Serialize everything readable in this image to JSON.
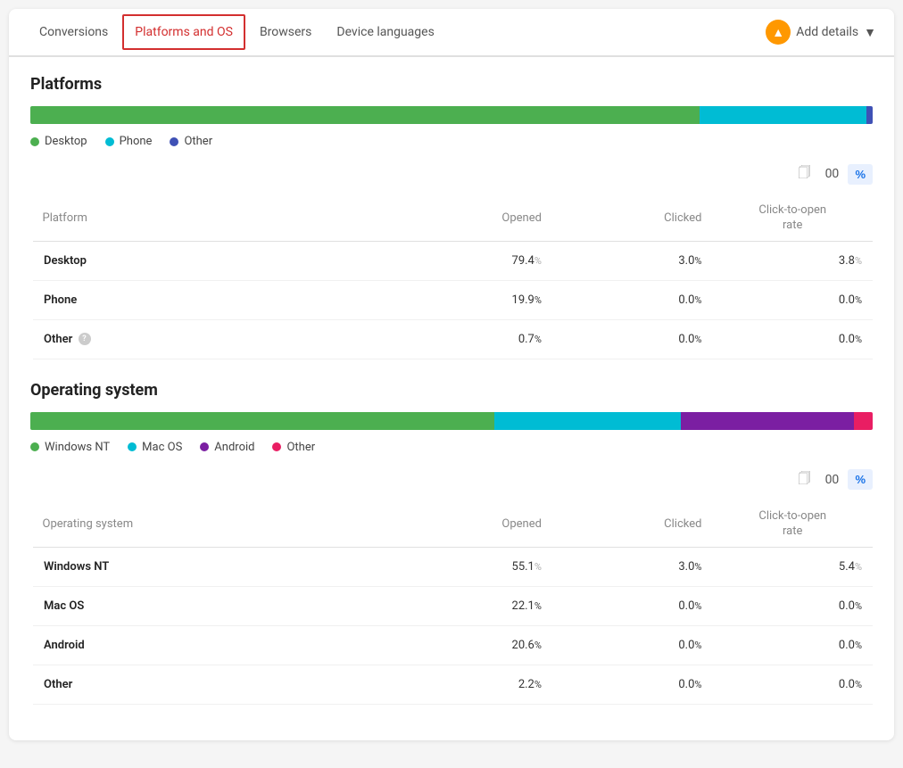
{
  "tabs": [
    {
      "label": "Conversions",
      "active": false
    },
    {
      "label": "Platforms and OS",
      "active": true
    },
    {
      "label": "Browsers",
      "active": false
    },
    {
      "label": "Device languages",
      "active": false
    }
  ],
  "addDetails": {
    "label": "Add details",
    "icon": "▼"
  },
  "platforms": {
    "sectionTitle": "Platforms",
    "bar": [
      {
        "color": "#4caf50",
        "pct": 79.4
      },
      {
        "color": "#00bcd4",
        "pct": 19.9
      },
      {
        "color": "#3f51b5",
        "pct": 0.7
      }
    ],
    "legend": [
      {
        "label": "Desktop",
        "color": "#4caf50"
      },
      {
        "label": "Phone",
        "color": "#00bcd4"
      },
      {
        "label": "Other",
        "color": "#3f51b5"
      }
    ],
    "metricValue": "00",
    "pctLabel": "%",
    "tableHeaders": {
      "platform": "Platform",
      "opened": "Opened",
      "clicked": "Clicked",
      "cto": "Click-to-open rate"
    },
    "rows": [
      {
        "name": "Desktop",
        "opened": "79.4",
        "openedPct": "%",
        "clicked": "3.0",
        "clickedPct": "%",
        "cto": "3.8",
        "ctoPct": "%"
      },
      {
        "name": "Phone",
        "opened": "19.9",
        "openedPct": "%",
        "clicked": "0.0",
        "clickedPct": "%",
        "cto": "0.0",
        "ctoPct": "%"
      },
      {
        "name": "Other",
        "opened": "0.7",
        "openedPct": "%",
        "clicked": "0.0",
        "clickedPct": "%",
        "cto": "0.0",
        "ctoPct": "%"
      }
    ]
  },
  "os": {
    "sectionTitle": "Operating system",
    "bar": [
      {
        "color": "#4caf50",
        "pct": 55.1
      },
      {
        "color": "#00bcd4",
        "pct": 22.1
      },
      {
        "color": "#7b1fa2",
        "pct": 20.6
      },
      {
        "color": "#e91e63",
        "pct": 2.2
      }
    ],
    "legend": [
      {
        "label": "Windows NT",
        "color": "#4caf50"
      },
      {
        "label": "Mac OS",
        "color": "#00bcd4"
      },
      {
        "label": "Android",
        "color": "#7b1fa2"
      },
      {
        "label": "Other",
        "color": "#e91e63"
      }
    ],
    "metricValue": "00",
    "pctLabel": "%",
    "tableHeaders": {
      "platform": "Operating system",
      "opened": "Opened",
      "clicked": "Clicked",
      "cto": "Click-to-open rate"
    },
    "rows": [
      {
        "name": "Windows NT",
        "opened": "55.1",
        "openedPct": "%",
        "clicked": "3.0",
        "clickedPct": "%",
        "cto": "5.4",
        "ctoPct": "%"
      },
      {
        "name": "Mac OS",
        "opened": "22.1",
        "openedPct": "%",
        "clicked": "0.0",
        "clickedPct": "%",
        "cto": "0.0",
        "ctoPct": "%"
      },
      {
        "name": "Android",
        "opened": "20.6",
        "openedPct": "%",
        "clicked": "0.0",
        "clickedPct": "%",
        "cto": "0.0",
        "ctoPct": "%"
      },
      {
        "name": "Other",
        "opened": "2.2",
        "openedPct": "%",
        "clicked": "0.0",
        "clickedPct": "%",
        "cto": "0.0",
        "ctoPct": "%"
      }
    ]
  }
}
